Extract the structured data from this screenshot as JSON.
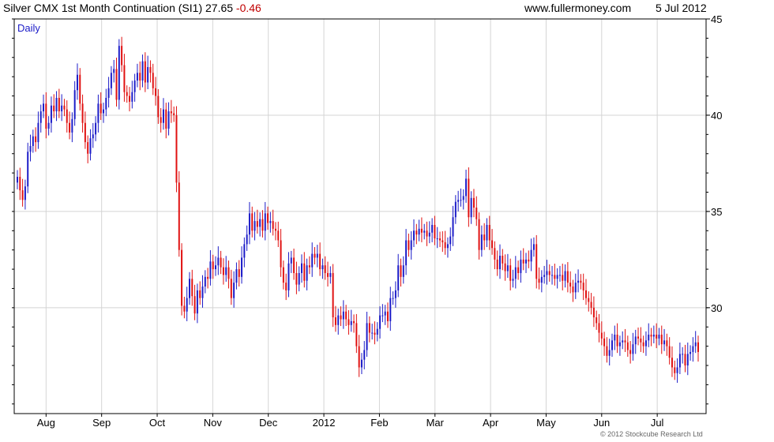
{
  "header": {
    "title": "Silver CMX 1st Month Continuation (SI1) 27.65",
    "change": "-0.46",
    "site": "www.fullermoney.com",
    "date": "5 Jul 2012"
  },
  "credit": "© 2012 Stockcube Research Ltd",
  "chart_data": {
    "type": "candlestick",
    "period": "Daily",
    "ylim": [
      24.5,
      45
    ],
    "y_ticks": [
      30,
      35,
      40,
      45
    ],
    "x_ticks": [
      "Aug",
      "Sep",
      "Oct",
      "Nov",
      "Dec",
      "2012",
      "Feb",
      "Mar",
      "Apr",
      "May",
      "Jun",
      "Jul"
    ],
    "grid": true,
    "colors": {
      "up": "#1c1cc8",
      "down": "#e01010",
      "grid": "#d4d4d4"
    },
    "series": [
      {
        "close": [
          36.8,
          36.1,
          35.6,
          36.3,
          38.1,
          38.4,
          38.9,
          38.6,
          39.6,
          40.2,
          40.6,
          39.3,
          39.6,
          40.5,
          40.2,
          40.9,
          40.2,
          40.5,
          40.3,
          39.6,
          39.1,
          39.8,
          41.3,
          42.1,
          40.6,
          39.6,
          38.6,
          38.0,
          38.8,
          39.0,
          39.6,
          40.6,
          40.1,
          40.3,
          40.9,
          41.4,
          42.2,
          42.4,
          40.8,
          43.6,
          42.6,
          41.2,
          41.0,
          40.7,
          41.2,
          41.8,
          42.2,
          41.8,
          42.8,
          41.7,
          42.5,
          42.2,
          41.4,
          41.0,
          39.9,
          39.6,
          40.3,
          39.3,
          40.2,
          40.1,
          40.0,
          36.5,
          33.0,
          30.1,
          29.8,
          30.5,
          31.5,
          30.6,
          29.7,
          30.9,
          30.5,
          31.1,
          31.6,
          31.5,
          32.4,
          32.0,
          32.2,
          32.6,
          32.1,
          31.7,
          32.1,
          31.5,
          30.5,
          31.3,
          32.0,
          31.6,
          32.6,
          33.3,
          33.8,
          34.9,
          34.0,
          34.5,
          34.2,
          34.6,
          34.0,
          34.9,
          34.4,
          34.5,
          34.1,
          34.0,
          33.5,
          32.1,
          31.3,
          30.9,
          32.3,
          32.6,
          31.8,
          31.2,
          31.8,
          32.3,
          31.4,
          32.2,
          32.1,
          32.8,
          32.6,
          32.8,
          32.0,
          32.2,
          31.8,
          31.6,
          31.8,
          29.5,
          29.1,
          29.6,
          29.4,
          29.8,
          29.4,
          29.1,
          29.3,
          29.2,
          28.0,
          26.9,
          27.3,
          27.8,
          29.2,
          28.7,
          28.7,
          28.6,
          28.9,
          29.6,
          29.6,
          29.8,
          29.3,
          30.5,
          30.5,
          30.9,
          32.2,
          31.6,
          32.2,
          33.5,
          33.0,
          33.5,
          34.0,
          33.8,
          34.1,
          33.9,
          34.0,
          33.7,
          33.9,
          34.3,
          33.6,
          33.6,
          33.5,
          33.4,
          33.1,
          33.3,
          33.7,
          34.7,
          35.5,
          35.6,
          35.6,
          35.8,
          36.7,
          34.7,
          35.7,
          35.2,
          34.6,
          33.0,
          33.8,
          33.5,
          34.3,
          33.5,
          33.1,
          32.5,
          32.0,
          32.7,
          32.3,
          31.9,
          32.2,
          31.4,
          31.5,
          32.1,
          31.8,
          32.5,
          32.3,
          32.5,
          32.4,
          33.0,
          33.3,
          31.5,
          31.3,
          31.6,
          31.7,
          31.9,
          31.7,
          31.7,
          31.5,
          31.7,
          31.7,
          31.4,
          31.9,
          31.3,
          31.1,
          30.8,
          31.3,
          31.4,
          31.3,
          30.9,
          30.5,
          30.3,
          30.0,
          29.5,
          29.2,
          28.7,
          28.4,
          28.0,
          27.5,
          27.8,
          28.3,
          28.6,
          28.0,
          28.2,
          28.3,
          28.2,
          27.8,
          27.6,
          28.1,
          28.5,
          28.4,
          28.2,
          28.0,
          28.3,
          28.6,
          28.5,
          28.6,
          28.4,
          28.6,
          28.1,
          28.3,
          28.0,
          27.4,
          26.9,
          26.6,
          26.9,
          27.6,
          27.6,
          27.0,
          27.6,
          27.7,
          28.0,
          28.2,
          27.7
        ]
      }
    ]
  }
}
